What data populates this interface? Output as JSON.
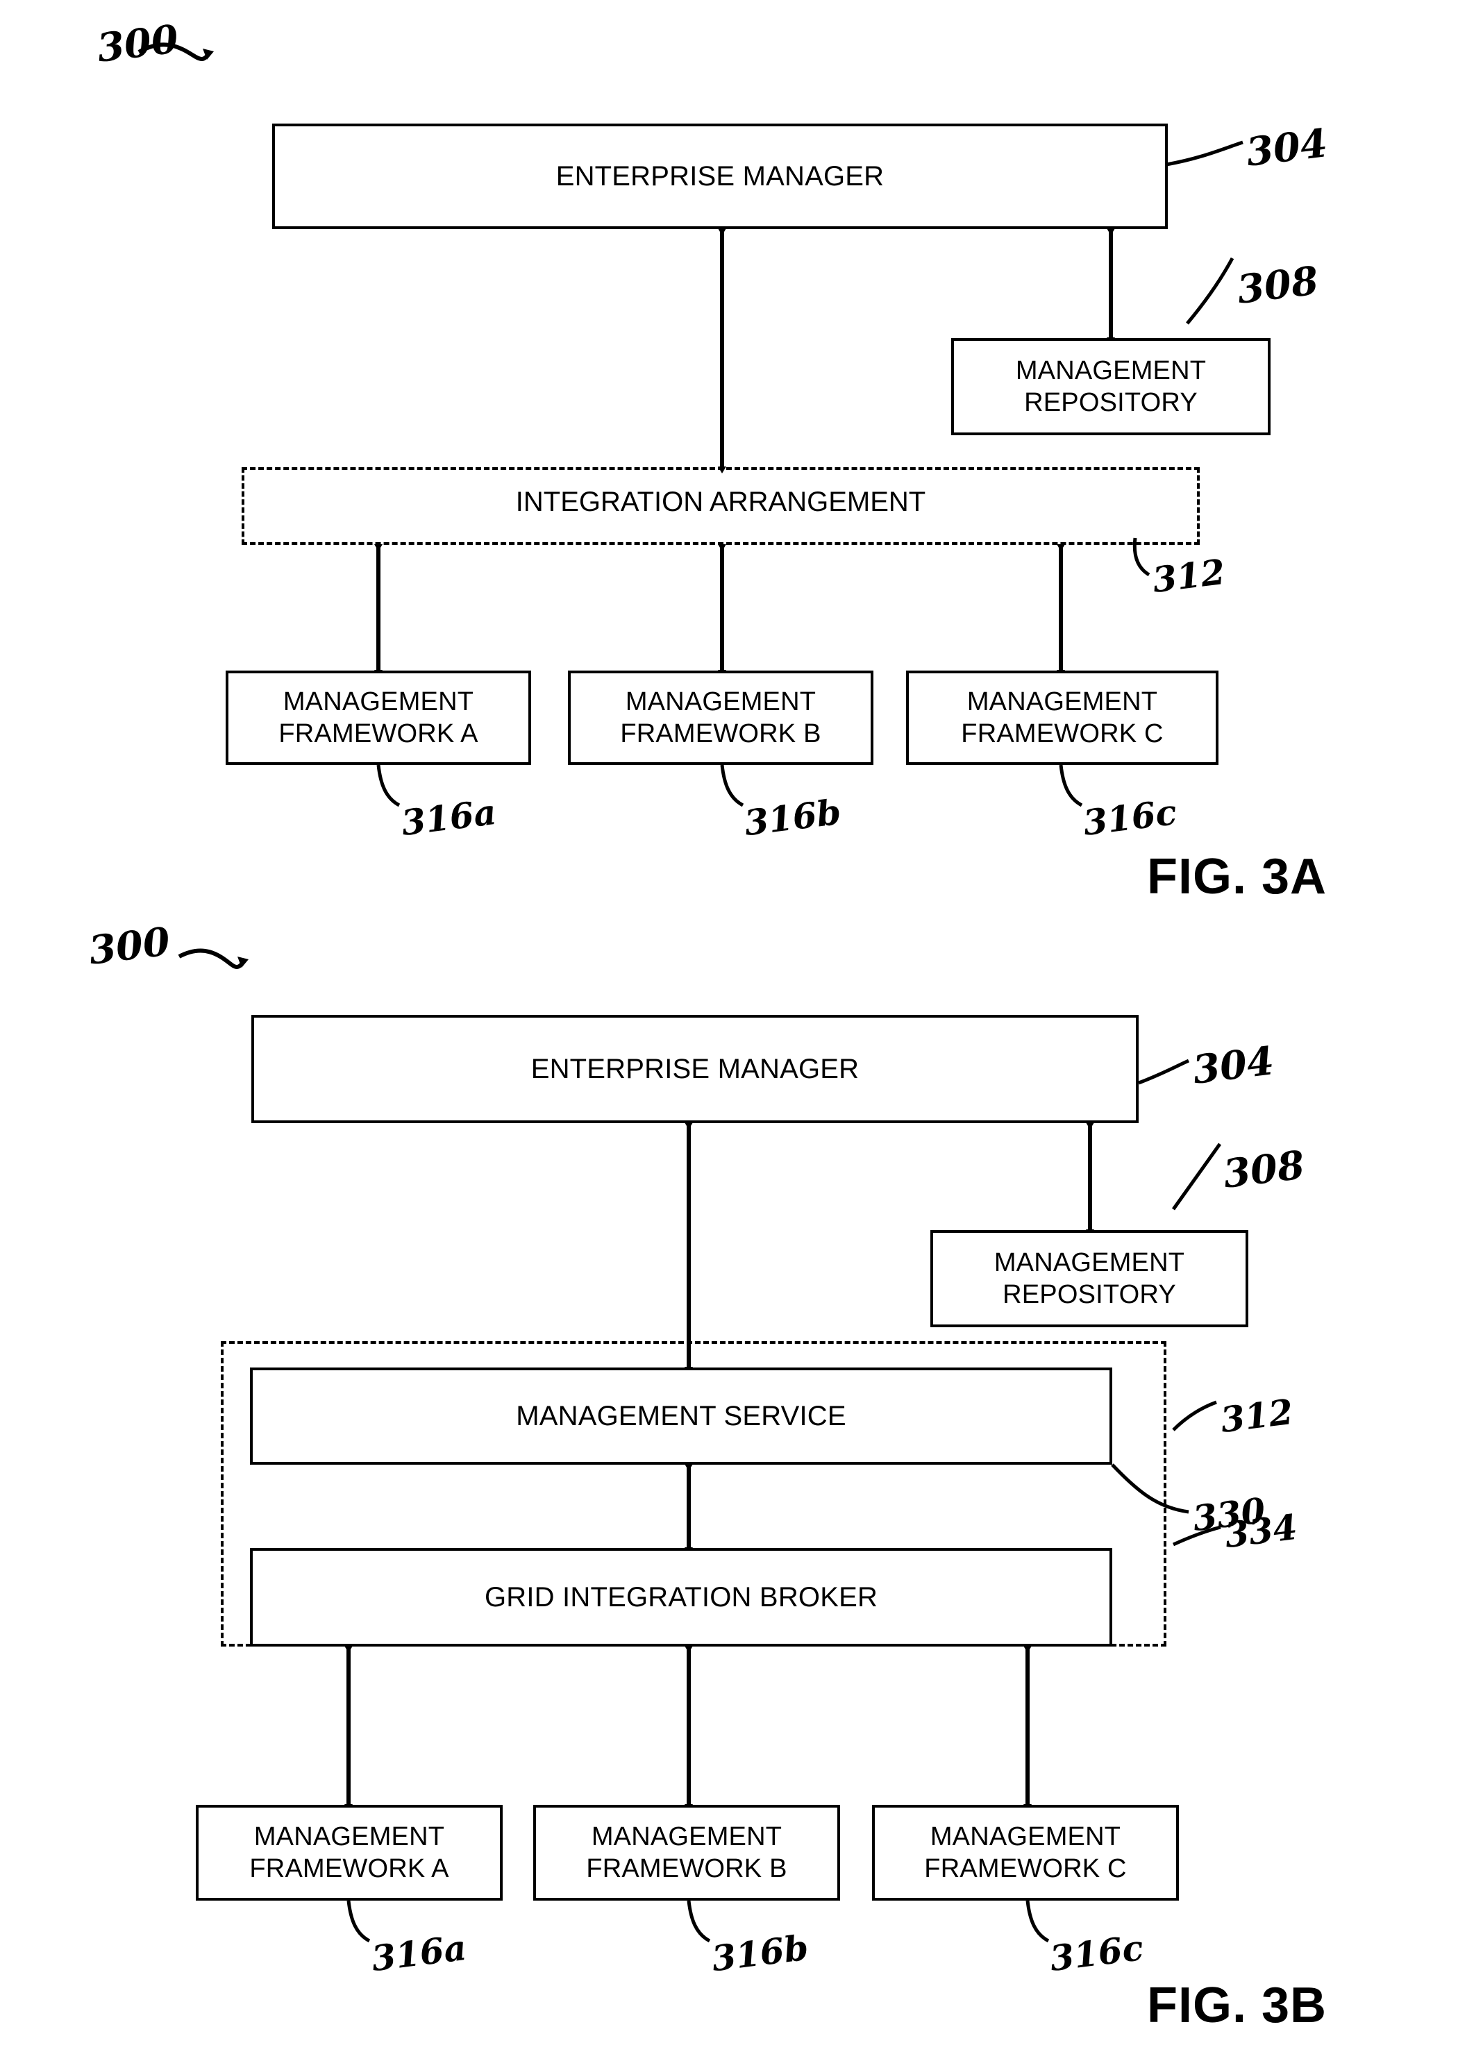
{
  "document": {
    "type": "patent-drawing-sheet",
    "figures": [
      "FIG. 3A",
      "FIG. 3B"
    ]
  },
  "fig3a": {
    "caption": "FIG. 3A",
    "system_ref": "300",
    "enterprise_manager": {
      "label": "ENTERPRISE MANAGER",
      "ref": "304"
    },
    "management_repository": {
      "label": "MANAGEMENT\nREPOSITORY",
      "ref": "308"
    },
    "integration_arrangement": {
      "label": "INTEGRATION ARRANGEMENT",
      "ref": "312"
    },
    "frameworks": [
      {
        "label": "MANAGEMENT\nFRAMEWORK A",
        "ref": "316a"
      },
      {
        "label": "MANAGEMENT\nFRAMEWORK B",
        "ref": "316b"
      },
      {
        "label": "MANAGEMENT\nFRAMEWORK C",
        "ref": "316c"
      }
    ]
  },
  "fig3b": {
    "caption": "FIG. 3B",
    "system_ref": "300",
    "enterprise_manager": {
      "label": "ENTERPRISE MANAGER",
      "ref": "304"
    },
    "management_repository": {
      "label": "MANAGEMENT\nREPOSITORY",
      "ref": "308"
    },
    "integration_arrangement": {
      "ref": "312"
    },
    "management_service": {
      "label": "MANAGEMENT SERVICE",
      "ref": "330"
    },
    "grid_integration_broker": {
      "label": "GRID INTEGRATION BROKER",
      "ref": "334"
    },
    "frameworks": [
      {
        "label": "MANAGEMENT\nFRAMEWORK A",
        "ref": "316a"
      },
      {
        "label": "MANAGEMENT\nFRAMEWORK B",
        "ref": "316b"
      },
      {
        "label": "MANAGEMENT\nFRAMEWORK C",
        "ref": "316c"
      }
    ]
  },
  "colors": {
    "ink": "#000000",
    "paper": "#ffffff"
  }
}
